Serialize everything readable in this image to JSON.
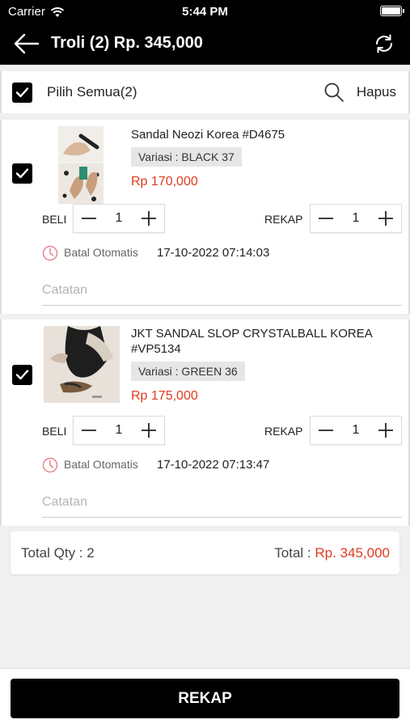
{
  "status_bar": {
    "carrier": "Carrier",
    "time": "5:44 PM"
  },
  "header": {
    "title": "Troli (2) Rp. 345,000"
  },
  "select_bar": {
    "select_all": "Pilih Semua(2)",
    "delete": "Hapus",
    "checked": true
  },
  "labels": {
    "beli": "BELI",
    "rekap": "REKAP",
    "auto_cancel": "Batal Otomatis",
    "note_placeholder": "Catatan"
  },
  "items": [
    {
      "name": "Sandal Neozi Korea #D4675",
      "variant": "Variasi : BLACK 37",
      "price": "Rp 170,000",
      "beli_qty": "1",
      "rekap_qty": "1",
      "auto_cancel_time": "17-10-2022 07:14:03",
      "note": "",
      "checked": true
    },
    {
      "name": "JKT SANDAL SLOP CRYSTALBALL KOREA #VP5134",
      "variant": "Variasi : GREEN 36",
      "price": "Rp 175,000",
      "beli_qty": "1",
      "rekap_qty": "1",
      "auto_cancel_time": "17-10-2022 07:13:47",
      "note": "",
      "checked": true
    }
  ],
  "totals": {
    "qty_label": "Total Qty : 2",
    "total_label": "Total : ",
    "total_value": "Rp. 345,000"
  },
  "footer": {
    "rekap_button": "REKAP"
  },
  "colors": {
    "accent": "#e03a1e",
    "primary": "#000000",
    "background": "#f0f0f0"
  },
  "icons": {
    "back": "arrow-left-icon",
    "refresh": "refresh-icon",
    "search": "search-icon",
    "clock": "clock-icon",
    "check": "checkmark-icon",
    "minus": "minus-icon",
    "plus": "plus-icon"
  }
}
